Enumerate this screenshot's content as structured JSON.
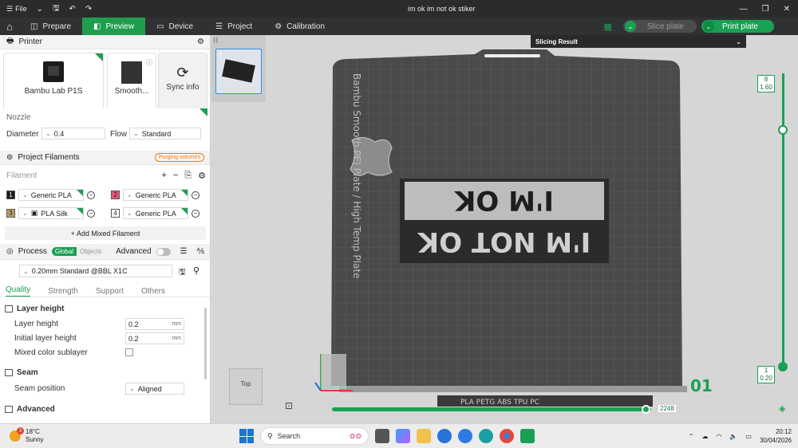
{
  "titlebar": {
    "file_label": "File",
    "window_title": "im ok im not ok stiker"
  },
  "toolbar": {
    "tabs": [
      "Prepare",
      "Preview",
      "Device",
      "Project",
      "Calibration"
    ],
    "slice_label": "Slice plate",
    "print_label": "Print plate"
  },
  "printer": {
    "section_title": "Printer",
    "printer_name": "Bambu Lab P1S",
    "plate_name": "Smooth...",
    "sync_label": "Sync info",
    "nozzle_label": "Nozzle",
    "diameter_label": "Diameter",
    "diameter_value": "0.4",
    "flow_label": "Flow",
    "flow_value": "Standard"
  },
  "filaments": {
    "section_title": "Project Filaments",
    "purging_label": "Purging volumes",
    "filament_label": "Filament",
    "items": [
      {
        "num": "1",
        "name": "Generic PLA",
        "color": "#1a1a1a"
      },
      {
        "num": "2",
        "name": "Generic PLA",
        "color": "#e8547a"
      },
      {
        "num": "3",
        "name": "PLA Silk",
        "color": "#b9a06a"
      },
      {
        "num": "4",
        "name": "Generic PLA",
        "color": "#ffffff"
      }
    ],
    "add_mixed_label": "+ Add Mixed Filament"
  },
  "process": {
    "section_title": "Process",
    "global_label": "Global",
    "objects_label": "Objects",
    "advanced_label": "Advanced",
    "profile": "0.20mm Standard @BBL X1C",
    "tabs": [
      "Quality",
      "Strength",
      "Support",
      "Others"
    ],
    "layer_height_group": "Layer height",
    "layer_height_label": "Layer height",
    "layer_height_value": "0.2",
    "initial_layer_label": "Initial layer height",
    "initial_layer_value": "0.2",
    "unit": "mm",
    "mixed_sublayer_label": "Mixed color sublayer",
    "seam_group": "Seam",
    "seam_position_label": "Seam position",
    "seam_position_value": "Aligned",
    "advanced_group": "Advanced"
  },
  "viewport": {
    "slicing_result": "Slicing Result",
    "plate_text": "Bambu Smooth PEI Plate / High Temp Plate",
    "sign_line1": "I'M OK",
    "sign_line2": "I'M NOT OK",
    "plate_number": "01",
    "plate_thumb_index": "1",
    "view_cube_label": "Top",
    "layer_top": "8",
    "height_top": "1.60",
    "layer_bottom": "1",
    "height_bottom": "0.20",
    "progress_value": "2248",
    "progress_fraction": 0.985,
    "plate_footer_text": "PLA PETG ABS TPU PC"
  },
  "taskbar": {
    "temp": "18°C",
    "condition": "Sunny",
    "weather_badge": "3",
    "search_label": "Search",
    "time": "20:12",
    "date": "30/04/2026"
  }
}
